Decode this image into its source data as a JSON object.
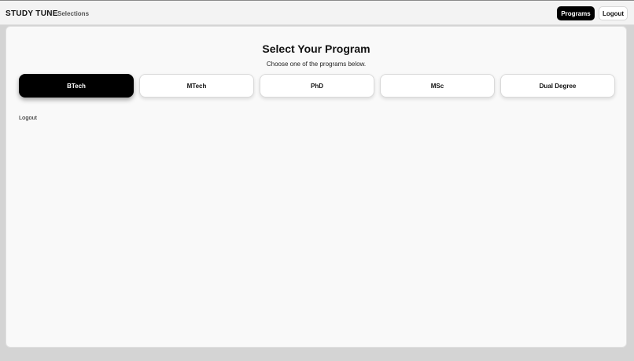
{
  "header": {
    "brand": "STUDY TUNE",
    "crumb": "Selections",
    "nav": {
      "programs_label": "Programs",
      "logout_label": "Logout"
    }
  },
  "main": {
    "title": "Select Your Program",
    "subtitle": "Choose one of the programs below.",
    "programs": [
      {
        "label": "BTech",
        "selected": true
      },
      {
        "label": "MTech",
        "selected": false
      },
      {
        "label": "PhD",
        "selected": false
      },
      {
        "label": "MSc",
        "selected": false
      },
      {
        "label": "Dual Degree",
        "selected": false
      }
    ],
    "logout_link": "Logout"
  },
  "colors": {
    "accent": "#000000",
    "page_bg": "#d4d4d4",
    "card_bg": "#f9f9f9"
  }
}
